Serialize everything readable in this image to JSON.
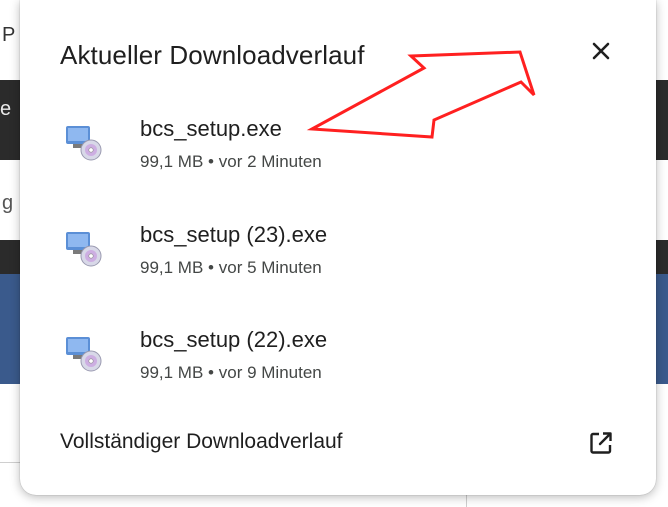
{
  "background": {
    "left_letter": "P",
    "dark_letter": "e",
    "left_char2": "g"
  },
  "bubble": {
    "title": "Aktueller Downloadverlauf",
    "close_icon": "close-icon",
    "items": [
      {
        "name": "bcs_setup.exe",
        "size": "99,1 MB",
        "separator": "•",
        "time": "vor 2 Minuten",
        "icon": "exe-installer-icon"
      },
      {
        "name": "bcs_setup (23).exe",
        "size": "99,1 MB",
        "separator": "•",
        "time": "vor 5 Minuten",
        "icon": "exe-installer-icon"
      },
      {
        "name": "bcs_setup (22).exe",
        "size": "99,1 MB",
        "separator": "•",
        "time": "vor 9 Minuten",
        "icon": "exe-installer-icon"
      }
    ],
    "footer_link": "Vollständiger Downloadverlauf",
    "open_icon": "open-in-new-icon"
  },
  "colors": {
    "annotation_arrow": "#ff2020",
    "text_primary": "#1f1f1f",
    "text_secondary": "#444746"
  }
}
